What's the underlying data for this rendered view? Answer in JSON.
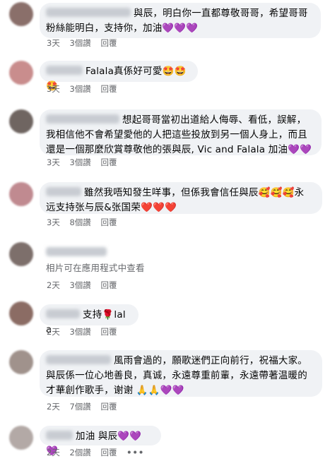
{
  "comments": [
    {
      "text": "與辰，明白你一直都尊敬哥哥，希望哥哥粉絲能明白，支持你，加油💜💜💜",
      "time": "3天",
      "views": "3個讚",
      "reply": "回覆",
      "avatar_color": "#8a6f6a"
    },
    {
      "text": "Falala真係好可愛🤩🤩🤩",
      "time": "3天",
      "views": "3個讚",
      "reply": "回覆",
      "avatar_color": "#c98d8d"
    },
    {
      "text": "想起哥哥當初出道給人侮辱、看低，誤解，我相信他不會希望愛他的人把這些投放到另一個人身上，而且還是一個那麼欣賞尊敬他的張與辰, Vic and Falala 加油💜💜",
      "time": "3天",
      "views": "3個讚",
      "reply": "回覆",
      "avatar_color": "#6f6561"
    },
    {
      "text": "雖然我唔知發生咩事，但係我會信任與辰🥰🥰🥰永远支持张与辰&张国荣❤️❤️❤️",
      "time": "3天",
      "views": "8個讚",
      "reply": "回覆",
      "avatar_color": "#c08a90"
    },
    {
      "text": "相片可在應用程式中查看",
      "time": "2天",
      "views": "3個讚",
      "reply": "回覆",
      "avatar_color": "#7d6f6b"
    },
    {
      "text": "支持🌹lala",
      "time": "2天",
      "views": "3個讚",
      "reply": "回覆",
      "avatar_color": "#8b6c64"
    },
    {
      "text": "風雨會過的，願歌迷們正向前行，祝福大家。與辰係一位心地善良，真诚，永遠尊重前輩，永遠帶著温暖的才華創作歌手，谢谢 🙏🙏💜💜",
      "time": "2天",
      "views": "7個讚",
      "reply": "回覆",
      "avatar_color": "#a0928c"
    },
    {
      "text": "加油 與辰💜💜💜",
      "time": "2天",
      "views": "2個讚",
      "reply": "回覆",
      "more": "•••",
      "avatar_color": "#b3a9a6"
    }
  ],
  "colors": {
    "bubble": "#f0f2f5",
    "meta": "#65676b",
    "text": "#050505"
  }
}
